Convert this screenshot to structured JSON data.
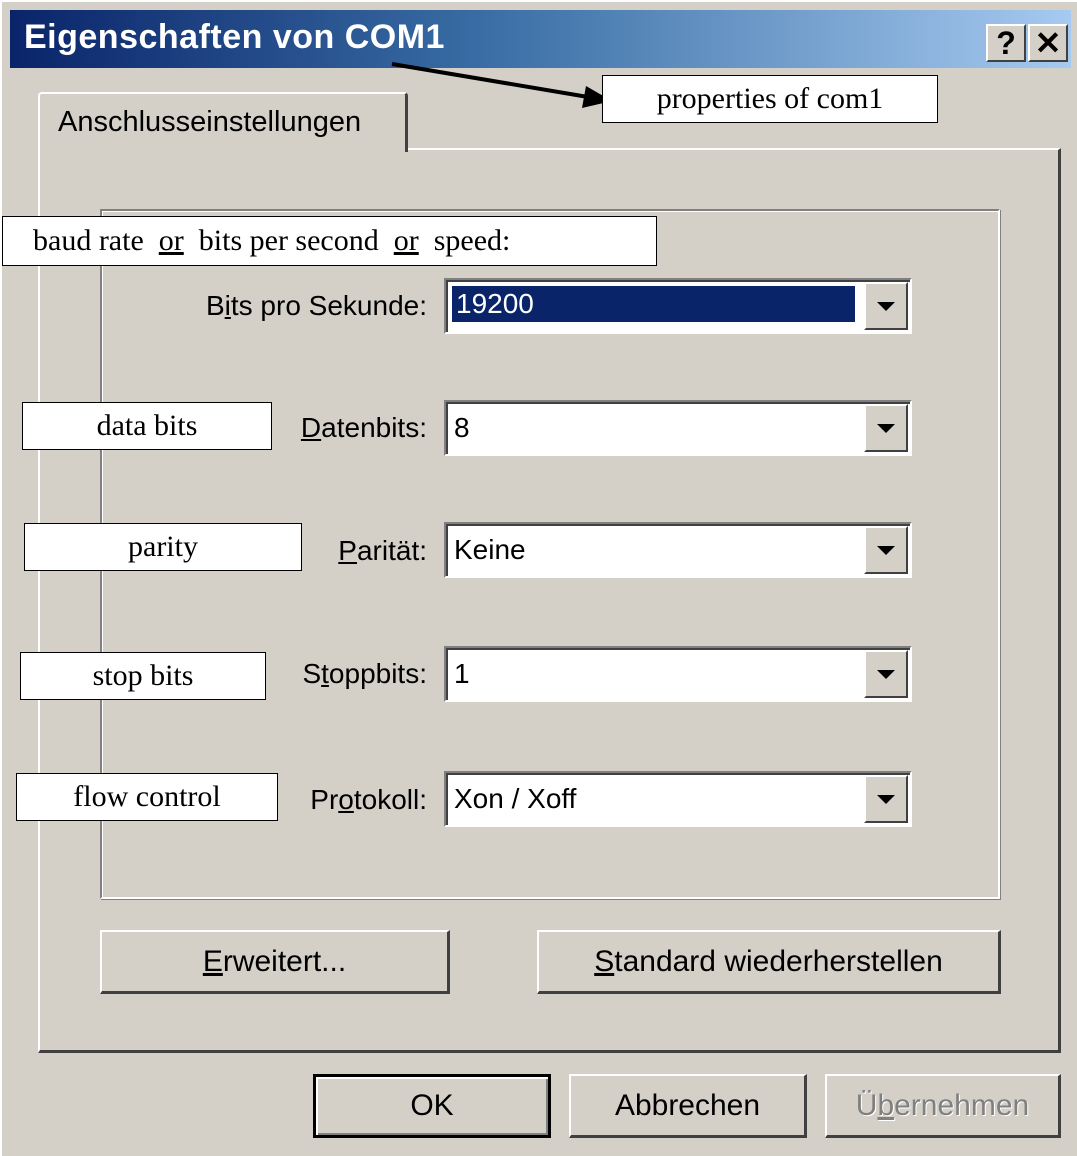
{
  "window": {
    "title": "Eigenschaften von COM1",
    "help_button": "?",
    "close_button": "✕"
  },
  "tab": {
    "label": "Anschlusseinstellungen"
  },
  "fields": {
    "bits": {
      "pre": "B",
      "acc": "i",
      "post": "ts pro Sekunde:",
      "value": "19200"
    },
    "datenbits": {
      "pre": "",
      "acc": "D",
      "post": "atenbits:",
      "value": "8"
    },
    "paritaet": {
      "pre": "",
      "acc": "P",
      "post": "arität:",
      "value": "Keine"
    },
    "stoppbits": {
      "pre": "S",
      "acc": "t",
      "post": "oppbits:",
      "value": "1"
    },
    "protokoll": {
      "pre": "Pr",
      "acc": "o",
      "post": "tokoll:",
      "value": "Xon / Xoff"
    }
  },
  "buttons": {
    "erweitert": {
      "acc": "E",
      "post": "rweitert..."
    },
    "standard": {
      "acc": "S",
      "post": "tandard wiederherstellen"
    },
    "ok": "OK",
    "abbrechen": "Abbrechen",
    "uebernehmen": {
      "pre": "Ü",
      "acc": "b",
      "post": "ernehmen"
    }
  },
  "annotations": {
    "properties": "properties of com1",
    "baud_part1": "baud rate",
    "baud_or1": "or",
    "baud_part2": "bits per second",
    "baud_or2": "or",
    "baud_part3": "speed:",
    "data_bits": "data bits",
    "parity": "parity",
    "stop_bits": "stop bits",
    "flow_control": "flow control"
  }
}
